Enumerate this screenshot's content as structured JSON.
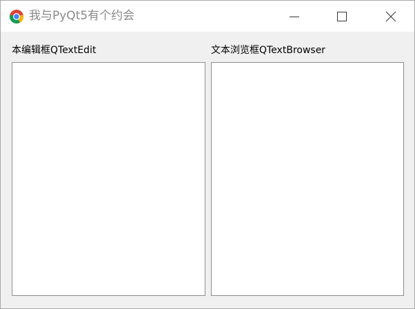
{
  "window": {
    "title": "我与PyQt5有个约会",
    "app_icon": "chrome-icon",
    "controls": {
      "minimize": "minimize-icon",
      "maximize": "maximize-icon",
      "close": "close-icon"
    }
  },
  "main": {
    "text_edit": {
      "label": "本编辑框QTextEdit",
      "value": ""
    },
    "text_browser": {
      "label": "文本浏览框QTextBrowser",
      "value": ""
    }
  },
  "colors": {
    "window_bg": "#f0f0f0",
    "titlebar_bg": "#ffffff",
    "title_text": "#8a8a8a",
    "textbox_border": "#8c8c8c"
  }
}
